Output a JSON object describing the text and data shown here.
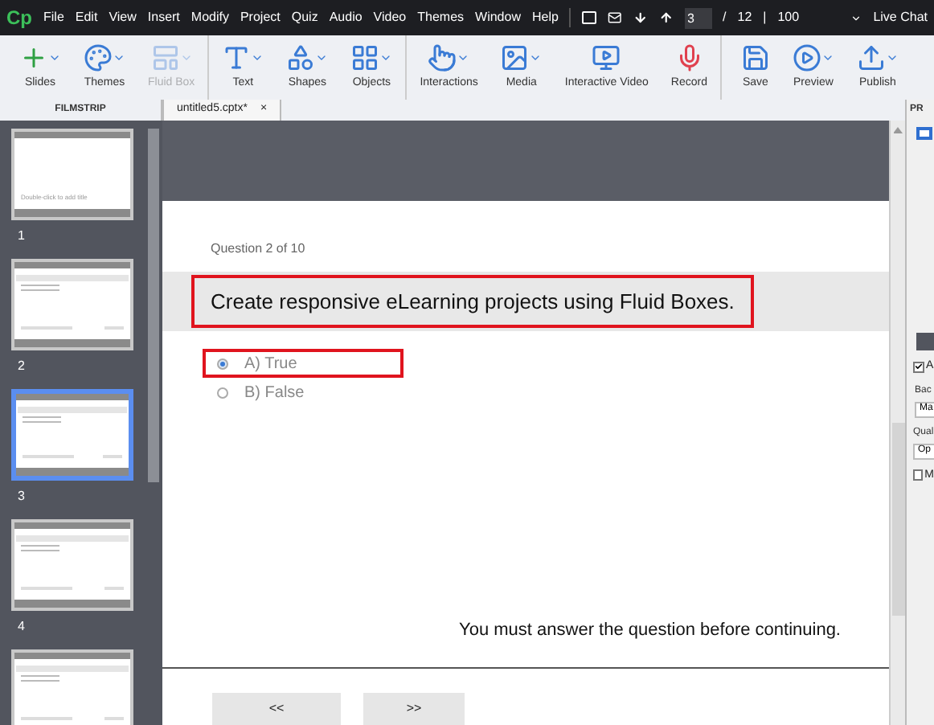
{
  "menu_bar": {
    "logo": "Cp",
    "items": [
      "File",
      "Edit",
      "View",
      "Insert",
      "Modify",
      "Project",
      "Quiz",
      "Audio",
      "Video",
      "Themes",
      "Window",
      "Help"
    ],
    "page_field": {
      "value": "3"
    },
    "page_separator": "/",
    "page_total": "12",
    "divider": "|",
    "zoom_field": {
      "value": "100"
    },
    "live_chat": "Live Chat"
  },
  "toolbar": {
    "groups": [
      [
        {
          "label": "Slides",
          "disabled": false,
          "has_menu": true
        },
        {
          "label": "Themes",
          "disabled": false,
          "has_menu": true
        },
        {
          "label": "Fluid Box",
          "disabled": true,
          "has_menu": true
        }
      ],
      [
        {
          "label": "Text",
          "disabled": false,
          "has_menu": true
        },
        {
          "label": "Shapes",
          "disabled": false,
          "has_menu": true
        },
        {
          "label": "Objects",
          "disabled": false,
          "has_menu": true
        }
      ],
      [
        {
          "label": "Interactions",
          "disabled": false,
          "has_menu": true
        },
        {
          "label": "Media",
          "disabled": false,
          "has_menu": true
        },
        {
          "label": "Interactive Video",
          "disabled": false,
          "has_menu": false
        },
        {
          "label": "Record",
          "disabled": false,
          "has_menu": false
        }
      ],
      [
        {
          "label": "Save",
          "disabled": false,
          "has_menu": false
        },
        {
          "label": "Preview",
          "disabled": false,
          "has_menu": true
        },
        {
          "label": "Publish",
          "disabled": false,
          "has_menu": true
        }
      ]
    ]
  },
  "filmstrip": {
    "title": "FILMSTRIP",
    "slides": [
      {
        "number": "1",
        "selected": false,
        "kind": "title",
        "title": "Double-click to add title"
      },
      {
        "number": "2",
        "selected": false,
        "kind": "quiz"
      },
      {
        "number": "3",
        "selected": true,
        "kind": "quiz"
      },
      {
        "number": "4",
        "selected": false,
        "kind": "quiz"
      },
      {
        "selected": false,
        "kind": "quiz"
      }
    ]
  },
  "document_tab": {
    "label": "untitled5.cptx*",
    "close": "×"
  },
  "slide": {
    "question_counter": "Question 2 of 10",
    "question": {
      "text": "Create responsive eLearning projects using Fluid Boxes.",
      "highlighted": true
    },
    "options": [
      {
        "label": "A) True",
        "selected": true,
        "highlighted": true
      },
      {
        "label": "B) False",
        "selected": false,
        "highlighted": false
      }
    ],
    "message": "You must answer the question before continuing.",
    "buttons": [
      "<<",
      ">>"
    ]
  },
  "properties": {
    "title": "PR",
    "checkbox_1": {
      "label": "A",
      "checked": true
    },
    "label_1": "Bac",
    "field_1": {
      "value": "Ma"
    },
    "label_2": "Qual",
    "field_2": {
      "value": "Op"
    },
    "checkbox_2": {
      "label": "M",
      "checked": false
    }
  }
}
